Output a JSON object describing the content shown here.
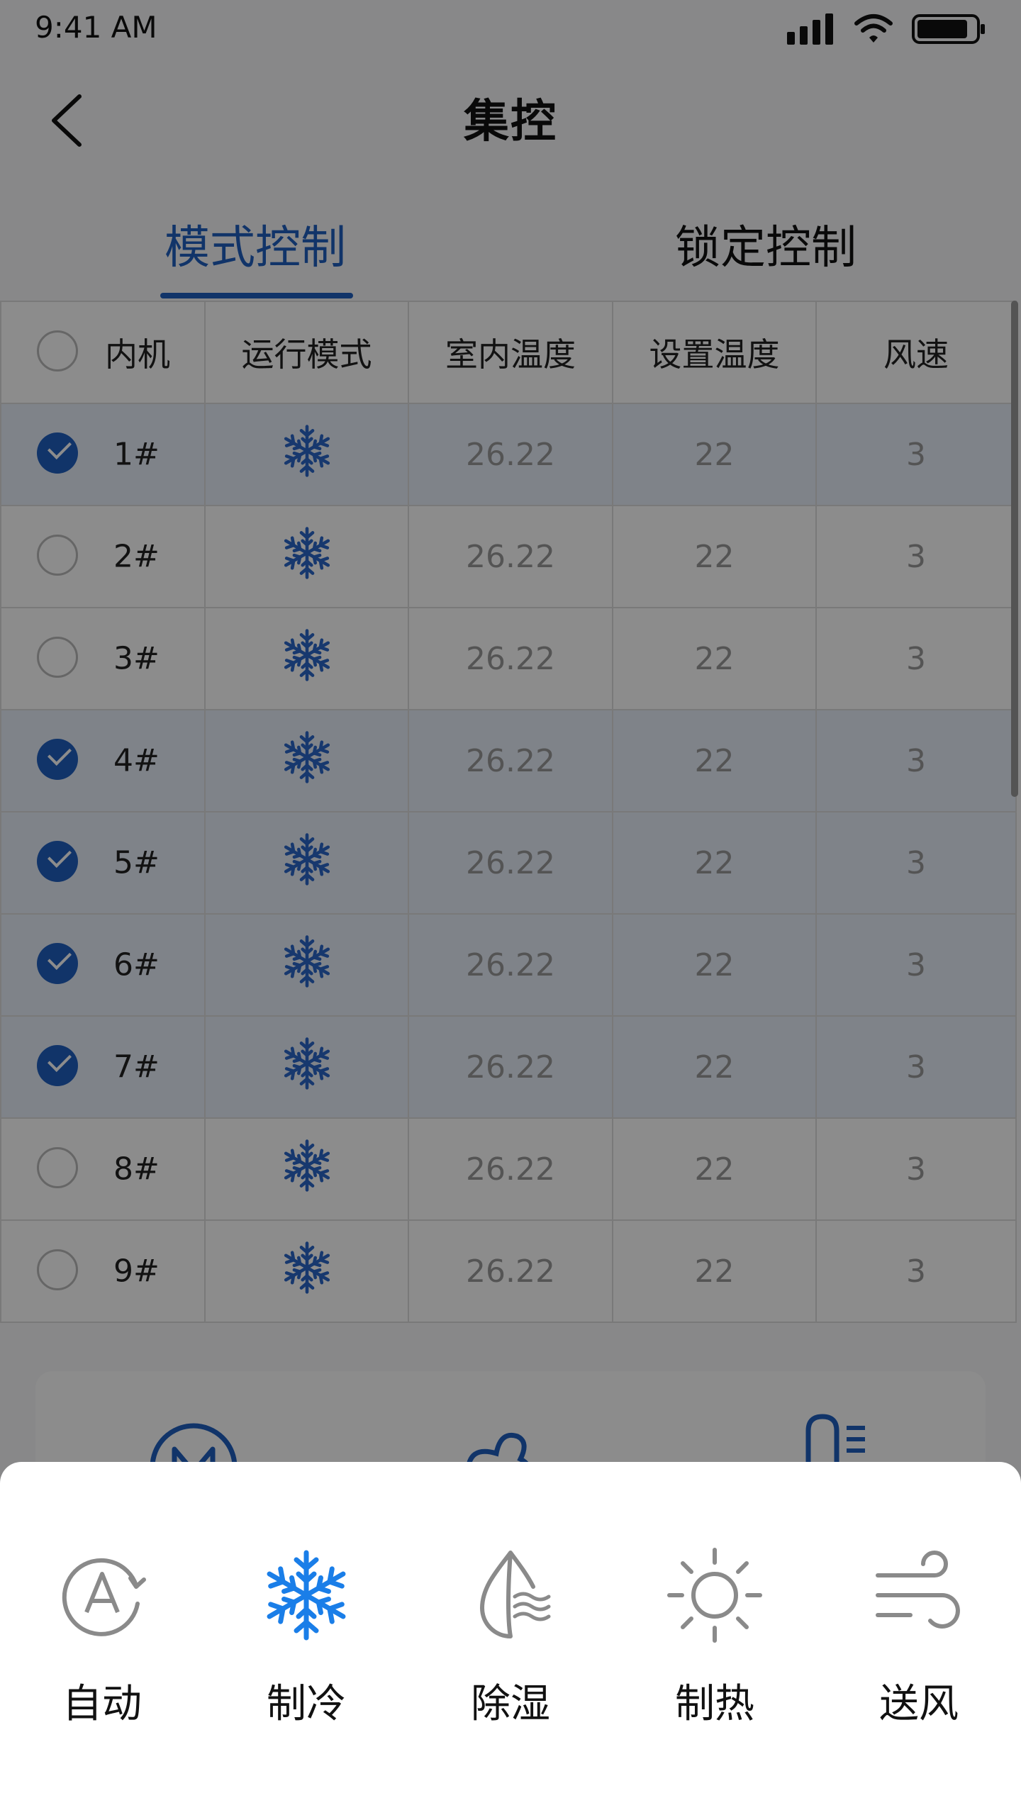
{
  "status_bar": {
    "time": "9:41 AM"
  },
  "header": {
    "title": "集控"
  },
  "tabs": [
    {
      "label": "模式控制",
      "active": true
    },
    {
      "label": "锁定控制",
      "active": false
    }
  ],
  "table": {
    "columns": [
      "内机",
      "运行模式",
      "室内温度",
      "设置温度",
      "风速"
    ],
    "rows": [
      {
        "unit": "1#",
        "selected": true,
        "mode": "snowflake-icon",
        "indoor_temp": "26.22",
        "set_temp": "22",
        "fan_speed": "3"
      },
      {
        "unit": "2#",
        "selected": false,
        "mode": "snowflake-icon",
        "indoor_temp": "26.22",
        "set_temp": "22",
        "fan_speed": "3"
      },
      {
        "unit": "3#",
        "selected": false,
        "mode": "snowflake-icon",
        "indoor_temp": "26.22",
        "set_temp": "22",
        "fan_speed": "3"
      },
      {
        "unit": "4#",
        "selected": true,
        "mode": "snowflake-icon",
        "indoor_temp": "26.22",
        "set_temp": "22",
        "fan_speed": "3"
      },
      {
        "unit": "5#",
        "selected": true,
        "mode": "snowflake-icon",
        "indoor_temp": "26.22",
        "set_temp": "22",
        "fan_speed": "3"
      },
      {
        "unit": "6#",
        "selected": true,
        "mode": "snowflake-icon",
        "indoor_temp": "26.22",
        "set_temp": "22",
        "fan_speed": "3"
      },
      {
        "unit": "7#",
        "selected": true,
        "mode": "snowflake-icon",
        "indoor_temp": "26.22",
        "set_temp": "22",
        "fan_speed": "3"
      },
      {
        "unit": "8#",
        "selected": false,
        "mode": "snowflake-icon",
        "indoor_temp": "26.22",
        "set_temp": "22",
        "fan_speed": "3"
      },
      {
        "unit": "9#",
        "selected": false,
        "mode": "snowflake-icon",
        "indoor_temp": "26.22",
        "set_temp": "22",
        "fan_speed": "3"
      }
    ]
  },
  "mode_sheet": {
    "items": [
      {
        "label": "自动",
        "icon": "auto-icon",
        "selected": false
      },
      {
        "label": "制冷",
        "icon": "snowflake-icon",
        "selected": true
      },
      {
        "label": "除湿",
        "icon": "dehumidify-icon",
        "selected": false
      },
      {
        "label": "制热",
        "icon": "sun-icon",
        "selected": false
      },
      {
        "label": "送风",
        "icon": "wind-icon",
        "selected": false
      }
    ]
  },
  "colors": {
    "accent": "#2060c0",
    "accent_bright": "#1a7ee8",
    "icon_gray": "#8a8a8a"
  }
}
